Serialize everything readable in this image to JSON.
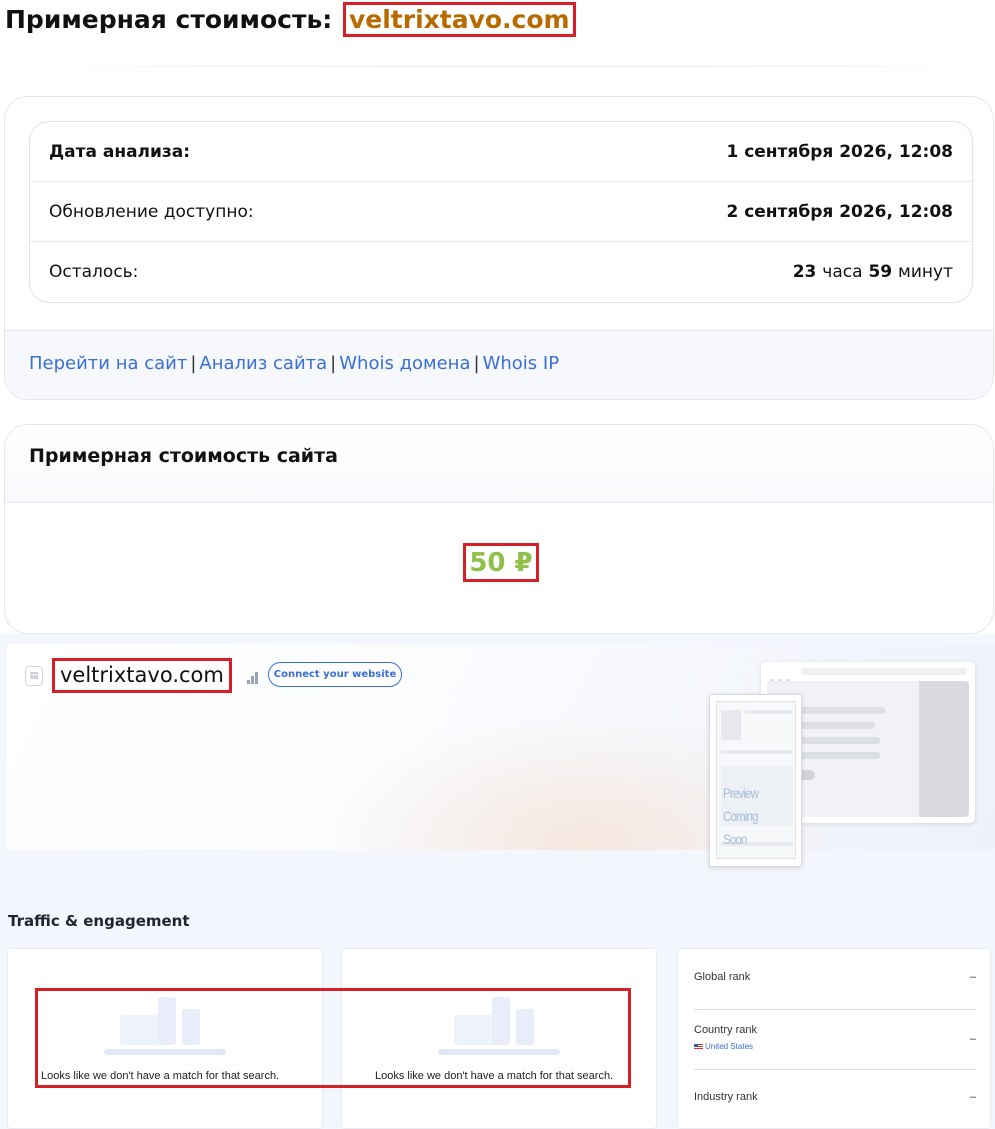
{
  "header": {
    "title_prefix": "Примерная стоимость:",
    "domain": "veltrixtavo.com"
  },
  "analysis": {
    "date_label": "Дата анализа:",
    "date_value": "1 сентября 2026, 12:08",
    "update_label": "Обновление доступно:",
    "update_value": "2 сентября 2026, 12:08",
    "remaining_label": "Осталось:",
    "remaining_hours": "23",
    "remaining_hours_unit": "часа",
    "remaining_minutes": "59",
    "remaining_minutes_unit": "минут"
  },
  "links": [
    "Перейти на сайт",
    "Анализ сайта",
    "Whois домена",
    "Whois IP"
  ],
  "price": {
    "heading": "Примерная стоимость сайта",
    "value": "50 ₽",
    "color": "#8ec04a"
  },
  "similarweb": {
    "domain": "veltrixtavo.com",
    "connect_button": "Connect your website",
    "preview_text_1": "Preview",
    "preview_text_2": "Coming Soon",
    "section_title": "Traffic & engagement",
    "empty_message": "Looks like we don't have a match for that search.",
    "ranks": [
      {
        "label": "Global rank",
        "value": "–"
      },
      {
        "label": "Country rank",
        "value": "–",
        "sub": "United States"
      },
      {
        "label": "Industry rank",
        "value": "–"
      }
    ]
  },
  "colors": {
    "link": "#3a6fd8",
    "highlight_border": "#d61f26",
    "domain_title": "#b86a00"
  }
}
